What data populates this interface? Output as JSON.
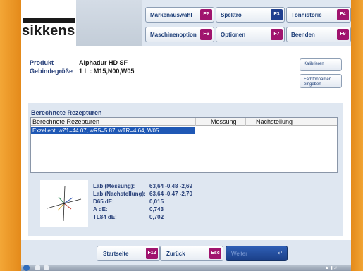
{
  "app": {
    "logo_text": "sikkens"
  },
  "top_buttons": [
    {
      "label": "Markenauswahl",
      "key": "F2"
    },
    {
      "label": "Spektro",
      "key": "F3"
    },
    {
      "label": "Tönhistorie",
      "key": "F4"
    },
    {
      "label": "Maschinenoption",
      "key": "F6"
    },
    {
      "label": "Optionen",
      "key": "F7"
    },
    {
      "label": "Beenden",
      "key": "F9"
    }
  ],
  "product": {
    "product_label": "Produkt",
    "product_value": "Alphadur HD SF",
    "size_label": "Gebindegröße",
    "size_value": "1 L : M15,N00,W05"
  },
  "side_buttons": {
    "calibrate": "Kalibrieren",
    "enter_name": "Farbtonnamen eingeben"
  },
  "recipes": {
    "title": "Berechnete Rezepturen",
    "columns": [
      "Berechnete Rezepturen",
      "Messung",
      "Nachstellung"
    ],
    "rows": [
      {
        "text": "Exzellent, wZ1=44.07, wR5=5.87, wTR=4.64, W05"
      }
    ]
  },
  "results": [
    {
      "label": "Lab (Messung):",
      "value": "63,64  -0,48  -2,69"
    },
    {
      "label": "Lab (Nachstellung):",
      "value": "63,64  -0,47  -2,70"
    },
    {
      "label": "D65 dE:",
      "value": "0,015"
    },
    {
      "label": "A dE:",
      "value": "0,743"
    },
    {
      "label": "TL84 dE:",
      "value": "0,702"
    }
  ],
  "footer": {
    "startseite": {
      "label": "Startseite",
      "key": "F12"
    },
    "zurueck": {
      "label": "Zurück",
      "key": "Esc"
    },
    "weiter": {
      "label": "Weiter",
      "icon": "enter-icon"
    }
  },
  "colors": {
    "accent_magenta": "#a0146e",
    "accent_blue": "#1f3f8f",
    "selection": "#1f58b5",
    "panel": "#dfe7f1",
    "desktop_orange": "#e8911c"
  }
}
